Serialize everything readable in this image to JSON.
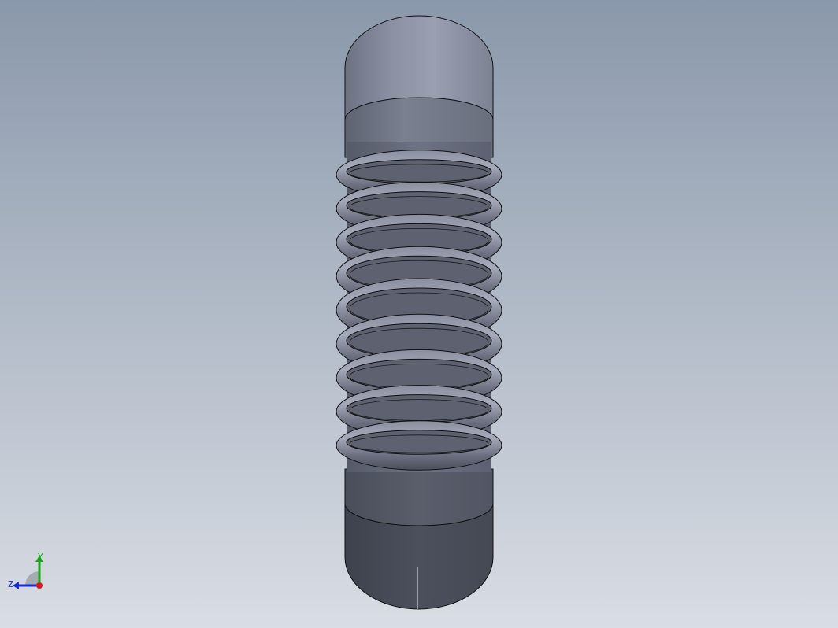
{
  "viewport": {
    "background_top": "#8a98ab",
    "background_bottom": "#d9dde4"
  },
  "model": {
    "name": "corrugated-bellows-hose",
    "body_color": "#6a6e7e",
    "edge_color": "#101010",
    "corrugation_count": 9
  },
  "triad": {
    "y_label": "Y",
    "z_label": "Z",
    "y_color": "#1aa51a",
    "z_color": "#1a2ad8",
    "x_color": "#d81a1a"
  }
}
